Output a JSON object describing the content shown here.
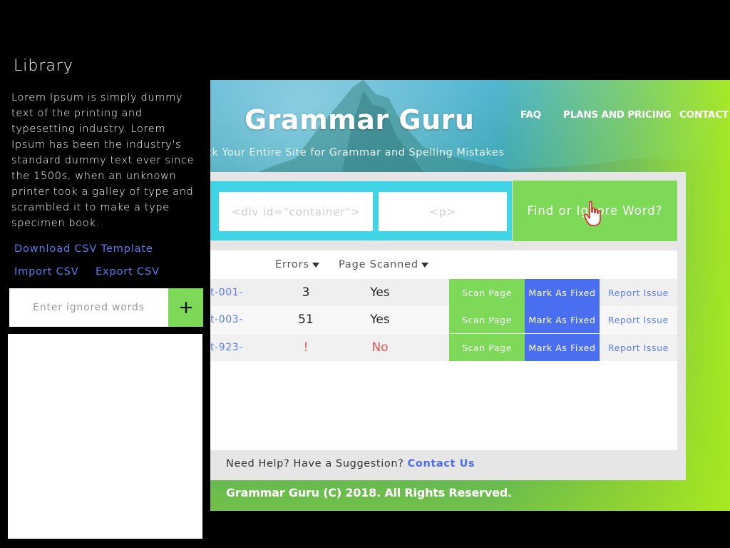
{
  "sidebar": {
    "title": "Library",
    "description": "Lorem Ipsum is simply dummy text of the printing and typesetting industry. Lorem Ipsum has been the industry's standard dummy text ever since the 1500s, when an unknown printer took a galley of type and scrambled it to make a type specimen book.",
    "download_link": "Download CSV Template",
    "import_link": "Import CSV",
    "export_link": "Export CSV",
    "ignore_input_placeholder": "Enter ignored words",
    "add_icon": "plus-icon"
  },
  "header": {
    "brand": "Grammar Guru",
    "nav": [
      "FAQ",
      "PLANS AND PRICING",
      "CONTACT"
    ],
    "tagline": "ck Your Entire Site for Grammar and Spelling Mistakes"
  },
  "search": {
    "field_1_placeholder": "<div id=\"container\">",
    "field_2_placeholder": "<p>",
    "find_button": "Find or Ignore Word?"
  },
  "table": {
    "headers": {
      "errors": "Errors",
      "scanned": "Page Scanned"
    },
    "rows": [
      {
        "page": "t-001-",
        "errors": "3",
        "scanned": "Yes",
        "scan": "Scan Page",
        "fixed": "Mark As Fixed",
        "report": "Report Issue"
      },
      {
        "page": "t-003-",
        "errors": "51",
        "scanned": "Yes",
        "scan": "Scan Page",
        "fixed": "Mark As Fixed",
        "report": "Report Issue"
      },
      {
        "page": "t-923-",
        "errors": "!",
        "scanned": "No",
        "scan": "Scan Page",
        "fixed": "Mark As Fixed",
        "report": "Report Issue"
      }
    ]
  },
  "help": {
    "text": "Need Help? Have a Suggestion?",
    "link": "Contact Us"
  },
  "footer": "Grammar Guru (C) 2018. All Rights Reserved.",
  "colors": {
    "green": "#7dd957",
    "cyan": "#3fd5e6",
    "blue": "#4a6ef0",
    "link": "#5a7cf0",
    "error": "#ee5252"
  }
}
